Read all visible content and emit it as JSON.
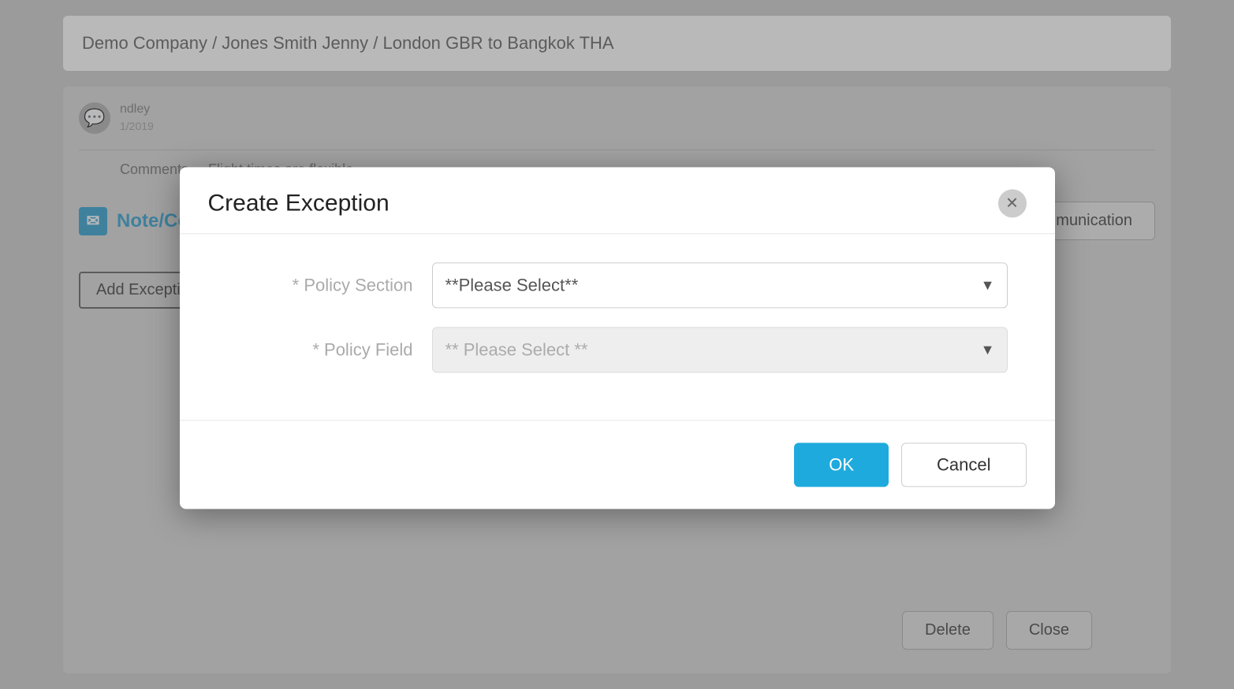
{
  "background": {
    "breadcrumb": "Demo Company / Jones Smith Jenny / London GBR to Bangkok THA",
    "comment_section": {
      "author_right": "ndley",
      "date_right": "1/2019",
      "comments_label": "Comments",
      "comment_text": "Flight times are flexible"
    },
    "notes_section": {
      "title": "Note/Communications",
      "new_communication_btn": "New Communication"
    },
    "add_exception_btn": "Add Exception",
    "help_icon": "?",
    "delete_btn": "Delete",
    "close_btn": "Close"
  },
  "modal": {
    "title": "Create Exception",
    "close_icon": "✕",
    "form": {
      "policy_section_label": "* Policy Section",
      "policy_section_placeholder": "**Please Select**",
      "policy_field_label": "* Policy Field",
      "policy_field_placeholder": "** Please Select **"
    },
    "ok_btn": "OK",
    "cancel_btn": "Cancel"
  }
}
